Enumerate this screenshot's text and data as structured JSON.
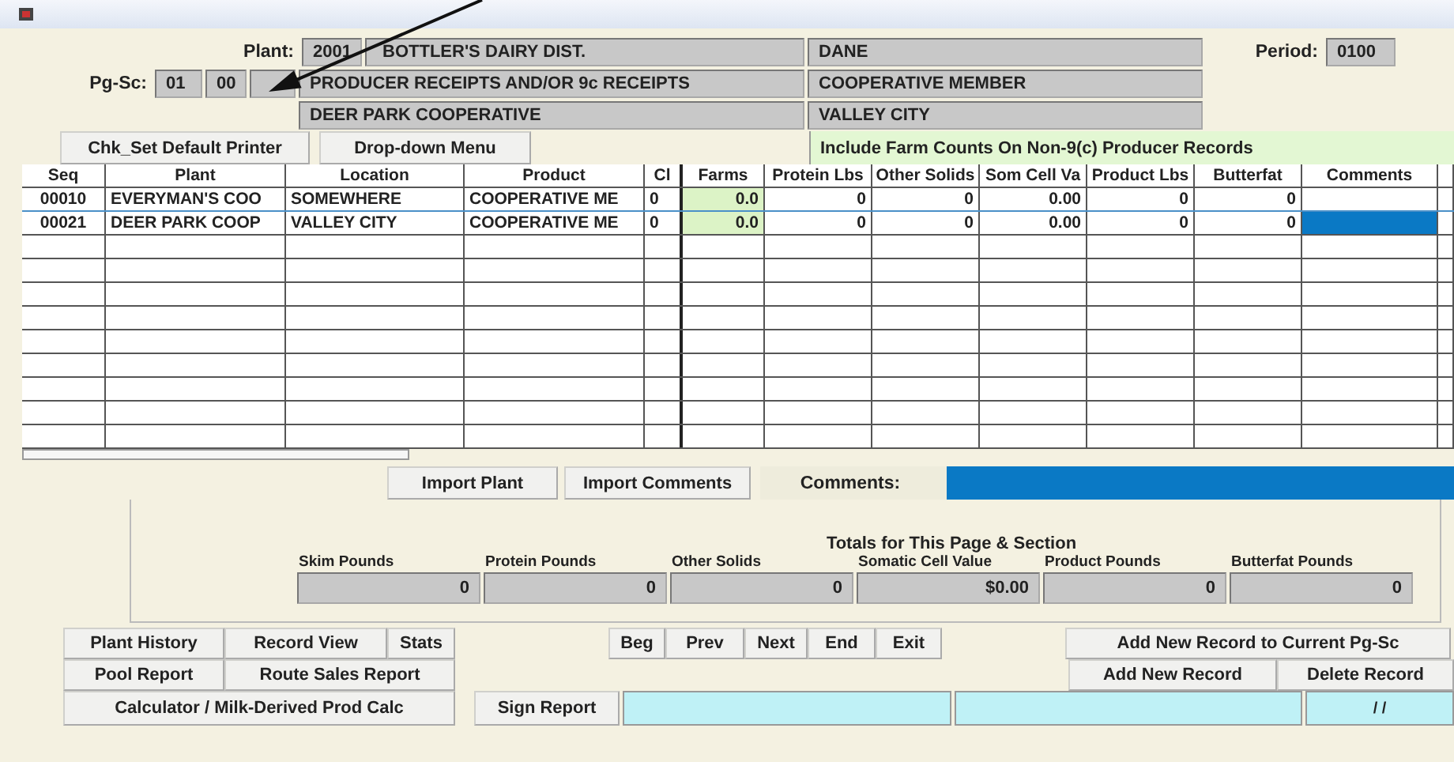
{
  "header": {
    "plant_label": "Plant:",
    "plant_code": "2001",
    "plant_name": "BOTTLER'S DAIRY DIST.",
    "county": "DANE",
    "period_label": "Period:",
    "period": "0100",
    "pgsc_label": "Pg-Sc:",
    "page": "01",
    "section": "00",
    "section_name": "PRODUCER RECEIPTS AND/OR 9c RECEIPTS",
    "member_type": "COOPERATIVE MEMBER",
    "cooperative": "DEER PARK COOPERATIVE",
    "city": "VALLEY CITY"
  },
  "top_buttons": [
    "Chk_Set Default Printer",
    "Drop-down Menu"
  ],
  "include_note": "Include Farm Counts On Non-9(c) Producer Records",
  "table": {
    "columns": [
      "Seq",
      "Plant",
      "Location",
      "Product",
      "Cl",
      "Farms",
      "Protein Lbs",
      "Other Solids",
      "Som Cell Va",
      "Product Lbs",
      "Butterfat",
      "Comments"
    ],
    "rows": [
      {
        "selected": false,
        "cells": [
          "00010",
          "EVERYMAN'S COO",
          "SOMEWHERE",
          "COOPERATIVE ME",
          "0",
          "0.0",
          "0",
          "0",
          "0.00",
          "0",
          "0"
        ]
      },
      {
        "selected": true,
        "cells": [
          "00021",
          "DEER PARK COOP",
          "VALLEY CITY",
          "COOPERATIVE ME",
          "0",
          "0.0",
          "0",
          "0",
          "0.00",
          "0",
          "0"
        ]
      }
    ]
  },
  "import_buttons": [
    "Import Plant",
    "Import Comments"
  ],
  "comments_label": "Comments:",
  "totals": {
    "title": "Totals for This Page & Section",
    "fields": [
      {
        "label": "Skim Pounds",
        "value": "0"
      },
      {
        "label": "Protein Pounds",
        "value": "0"
      },
      {
        "label": "Other Solids",
        "value": "0"
      },
      {
        "label": "Somatic Cell Value",
        "value": "$0.00"
      },
      {
        "label": "Product Pounds",
        "value": "0"
      },
      {
        "label": "Butterfat Pounds",
        "value": "0"
      }
    ]
  },
  "left_buttons": [
    [
      "Plant History",
      "Record View",
      "Stats"
    ],
    [
      "Pool Report",
      "Route Sales Report"
    ],
    [
      "Calculator / Milk-Derived Prod Calc"
    ]
  ],
  "nav_buttons": [
    "Beg",
    "Prev",
    "Next",
    "End",
    "Exit"
  ],
  "add_current_button": "Add New Record to Current Pg-Sc",
  "record_buttons": [
    "Add New Record",
    "Delete Record"
  ],
  "sign_button": "Sign Report",
  "sign_date": "/ /"
}
